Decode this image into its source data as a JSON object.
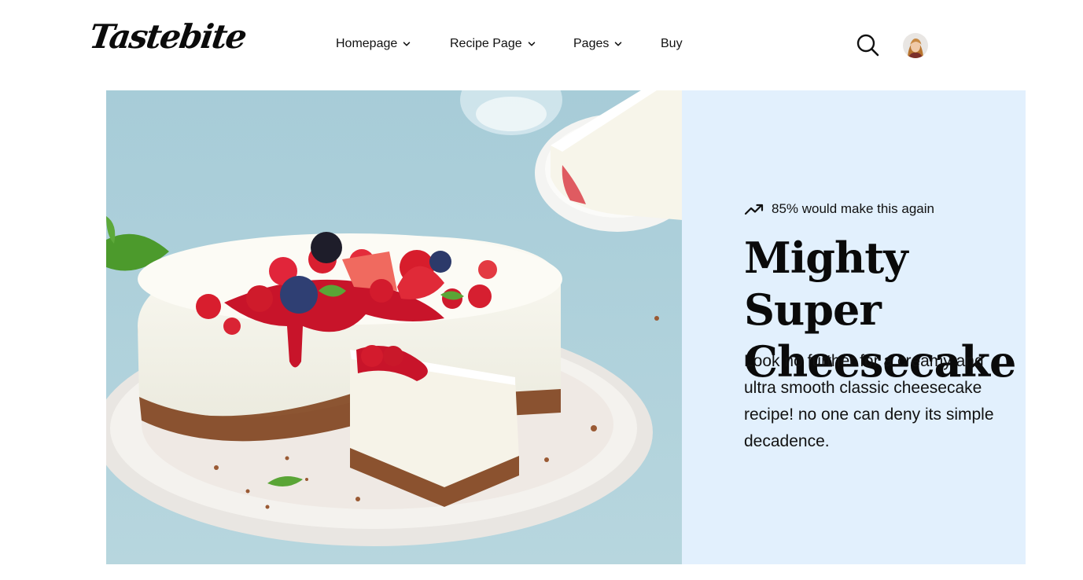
{
  "brand": {
    "logo_text": "Tastebite"
  },
  "nav": {
    "items": [
      {
        "label": "Homepage",
        "has_dropdown": true
      },
      {
        "label": "Recipe Page",
        "has_dropdown": true
      },
      {
        "label": "Pages",
        "has_dropdown": true
      },
      {
        "label": "Buy",
        "has_dropdown": false
      }
    ],
    "icons": {
      "search": "search-icon",
      "profile": "user-avatar",
      "dropdown": "chevron-down-icon"
    }
  },
  "hero": {
    "stat_icon": "trending-up-icon",
    "stat_text": "85% would make this again",
    "title_line1": "Mighty Super",
    "title_line2": "Cheesecake",
    "description": "Look no further for a creamy and ultra smooth classic cheesecake recipe! no one can deny its simple decadence.",
    "image_subject": "cheesecake-with-berries",
    "panel_color": "#e2f0fd",
    "table_color": "#a9cfdc"
  }
}
